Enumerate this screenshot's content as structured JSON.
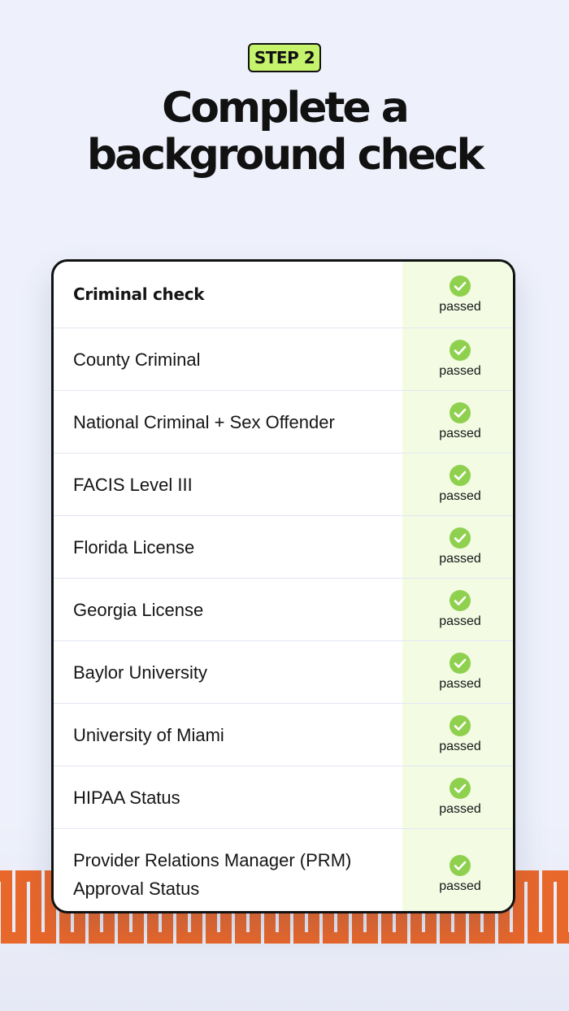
{
  "header": {
    "step_label": "STEP 2",
    "title_line1": "Complete a",
    "title_line2": "background check"
  },
  "colors": {
    "background": "#eef1fb",
    "badge_fill": "#c6f36c",
    "status_column": "#f3fbe3",
    "check_green": "#8fd14f",
    "zigzag_orange": "#e8672a"
  },
  "checks": {
    "header_row": {
      "label": "Criminal check",
      "status": "passed"
    },
    "rows": [
      {
        "label": "County Criminal",
        "status": "passed"
      },
      {
        "label": "National Criminal + Sex Offender",
        "status": "passed"
      },
      {
        "label": "FACIS Level III",
        "status": "passed"
      },
      {
        "label": "Florida License",
        "status": "passed"
      },
      {
        "label": "Georgia License",
        "status": "passed"
      },
      {
        "label": "Baylor University",
        "status": "passed"
      },
      {
        "label": "University of Miami",
        "status": "passed"
      },
      {
        "label": "HIPAA Status",
        "status": "passed"
      },
      {
        "label": "Provider Relations Manager (PRM) Approval Status",
        "status": "passed"
      }
    ]
  },
  "icons": {
    "status_icon": "check-circle-icon",
    "decoration": "zigzag-pattern"
  }
}
